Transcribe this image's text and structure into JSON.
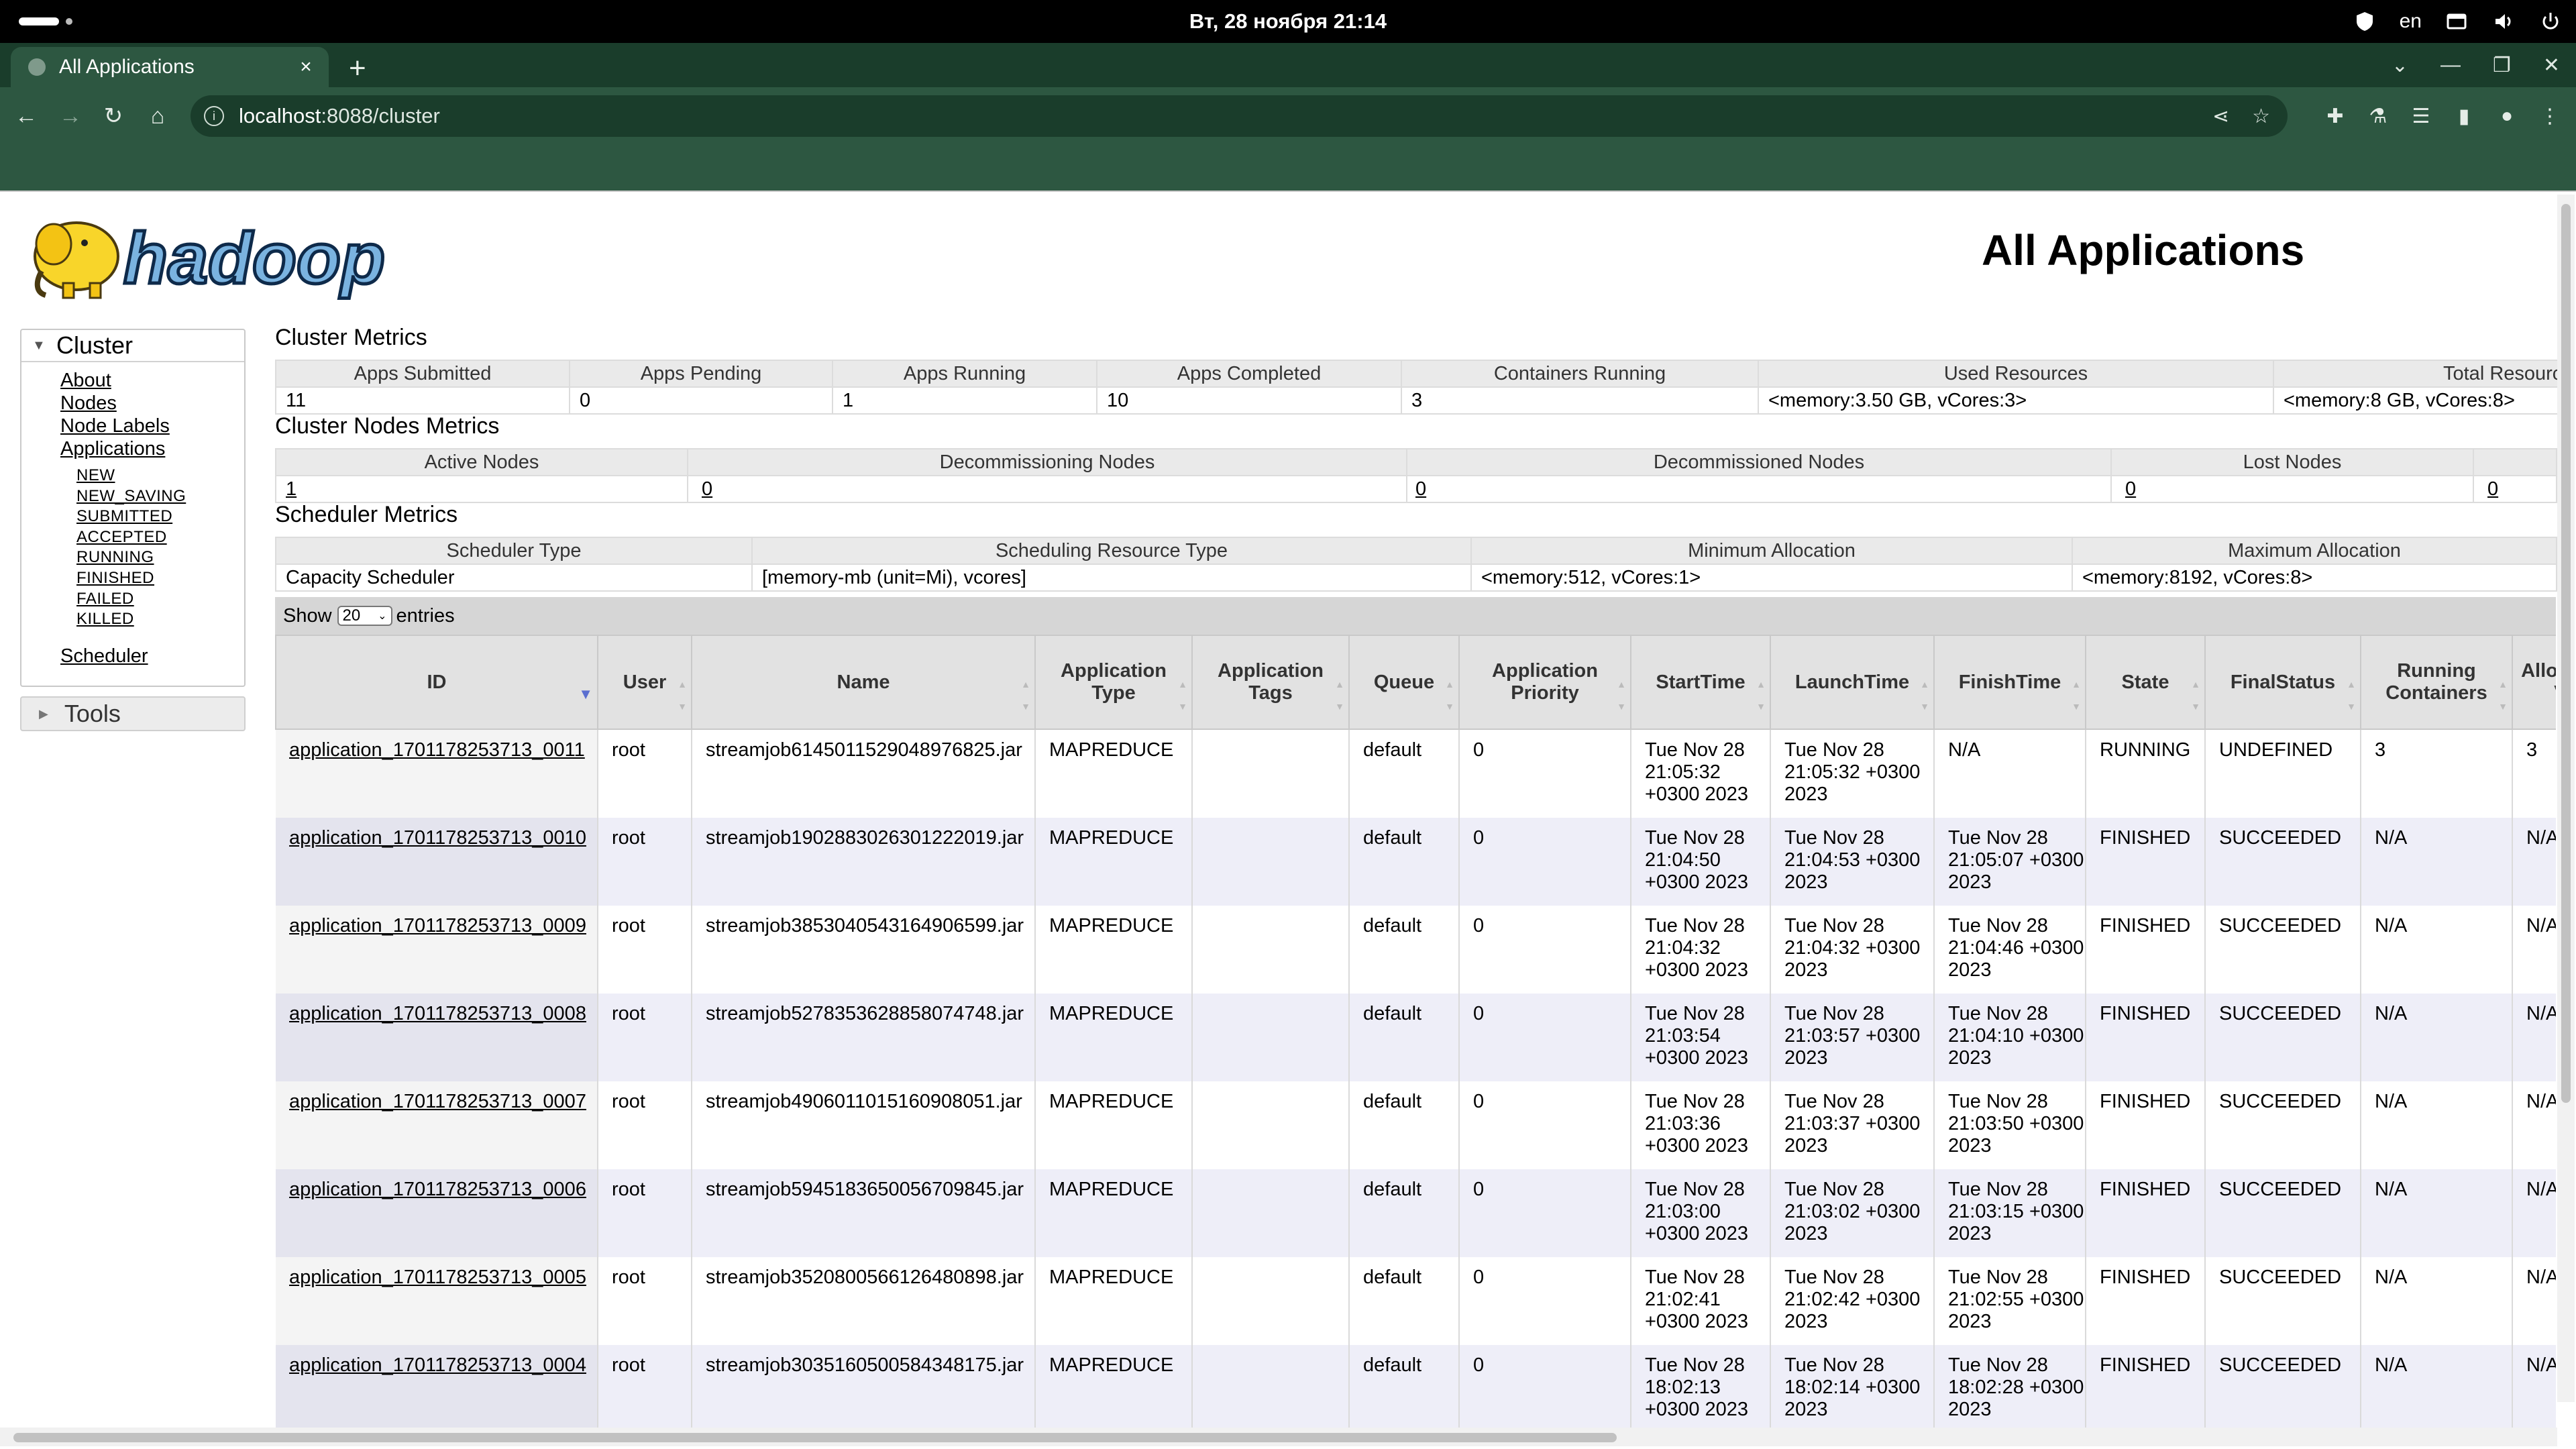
{
  "os_bar": {
    "clock": "Вт, 28 ноября  21:14",
    "language": "en"
  },
  "browser": {
    "tab_title": "All Applications",
    "tab_close": "×",
    "new_tab": "+",
    "url_host": "localhost",
    "url_rest": ":8088/cluster"
  },
  "page": {
    "logo_text": "hadoop",
    "title": "All Applications"
  },
  "sidebar": {
    "cluster_label": "Cluster",
    "links": [
      "About",
      "Nodes",
      "Node Labels",
      "Applications"
    ],
    "app_states": [
      "NEW",
      "NEW_SAVING",
      "SUBMITTED",
      "ACCEPTED",
      "RUNNING",
      "FINISHED",
      "FAILED",
      "KILLED"
    ],
    "scheduler_link": "Scheduler",
    "tools_label": "Tools"
  },
  "cluster_metrics": {
    "title": "Cluster Metrics",
    "headers": [
      "Apps Submitted",
      "Apps Pending",
      "Apps Running",
      "Apps Completed",
      "Containers Running",
      "Used Resources",
      "Total Resources"
    ],
    "values": [
      "11",
      "0",
      "1",
      "10",
      "3",
      "<memory:3.50 GB, vCores:3>",
      "<memory:8 GB, vCores:8>"
    ]
  },
  "node_metrics": {
    "title": "Cluster Nodes Metrics",
    "headers": [
      "Active Nodes",
      "Decommissioning Nodes",
      "Decommissioned Nodes",
      "Lost Nodes",
      ""
    ],
    "values": [
      "1",
      "0",
      "0",
      "0",
      "0"
    ]
  },
  "scheduler_metrics": {
    "title": "Scheduler Metrics",
    "headers": [
      "Scheduler Type",
      "Scheduling Resource Type",
      "Minimum Allocation",
      "Maximum Allocation"
    ],
    "values": [
      "Capacity Scheduler",
      "[memory-mb (unit=Mi), vcores]",
      "<memory:512, vCores:1>",
      "<memory:8192, vCores:8>"
    ]
  },
  "entries": {
    "show_label": "Show",
    "page_size": "20",
    "entries_label": "entries"
  },
  "apps_table": {
    "headers": [
      "ID",
      "User",
      "Name",
      "Application Type",
      "Application Tags",
      "Queue",
      "Application Priority",
      "StartTime",
      "LaunchTime",
      "FinishTime",
      "State",
      "FinalStatus",
      "Running Containers",
      "Allocated CPU VCores"
    ],
    "rows": [
      {
        "id": "application_1701178253713_0011",
        "user": "root",
        "name": "streamjob6145011529048976825.jar",
        "type": "MAPREDUCE",
        "tags": "",
        "queue": "default",
        "priority": "0",
        "start": "Tue Nov 28 21:05:32 +0300 2023",
        "launch": "Tue Nov 28 21:05:32 +0300 2023",
        "finish": "N/A",
        "state": "RUNNING",
        "final": "UNDEFINED",
        "containers": "3",
        "vcores": "3"
      },
      {
        "id": "application_1701178253713_0010",
        "user": "root",
        "name": "streamjob1902883026301222019.jar",
        "type": "MAPREDUCE",
        "tags": "",
        "queue": "default",
        "priority": "0",
        "start": "Tue Nov 28 21:04:50 +0300 2023",
        "launch": "Tue Nov 28 21:04:53 +0300 2023",
        "finish": "Tue Nov 28 21:05:07 +0300 2023",
        "state": "FINISHED",
        "final": "SUCCEEDED",
        "containers": "N/A",
        "vcores": "N/A"
      },
      {
        "id": "application_1701178253713_0009",
        "user": "root",
        "name": "streamjob3853040543164906599.jar",
        "type": "MAPREDUCE",
        "tags": "",
        "queue": "default",
        "priority": "0",
        "start": "Tue Nov 28 21:04:32 +0300 2023",
        "launch": "Tue Nov 28 21:04:32 +0300 2023",
        "finish": "Tue Nov 28 21:04:46 +0300 2023",
        "state": "FINISHED",
        "final": "SUCCEEDED",
        "containers": "N/A",
        "vcores": "N/A"
      },
      {
        "id": "application_1701178253713_0008",
        "user": "root",
        "name": "streamjob5278353628858074748.jar",
        "type": "MAPREDUCE",
        "tags": "",
        "queue": "default",
        "priority": "0",
        "start": "Tue Nov 28 21:03:54 +0300 2023",
        "launch": "Tue Nov 28 21:03:57 +0300 2023",
        "finish": "Tue Nov 28 21:04:10 +0300 2023",
        "state": "FINISHED",
        "final": "SUCCEEDED",
        "containers": "N/A",
        "vcores": "N/A"
      },
      {
        "id": "application_1701178253713_0007",
        "user": "root",
        "name": "streamjob4906011015160908051.jar",
        "type": "MAPREDUCE",
        "tags": "",
        "queue": "default",
        "priority": "0",
        "start": "Tue Nov 28 21:03:36 +0300 2023",
        "launch": "Tue Nov 28 21:03:37 +0300 2023",
        "finish": "Tue Nov 28 21:03:50 +0300 2023",
        "state": "FINISHED",
        "final": "SUCCEEDED",
        "containers": "N/A",
        "vcores": "N/A"
      },
      {
        "id": "application_1701178253713_0006",
        "user": "root",
        "name": "streamjob5945183650056709845.jar",
        "type": "MAPREDUCE",
        "tags": "",
        "queue": "default",
        "priority": "0",
        "start": "Tue Nov 28 21:03:00 +0300 2023",
        "launch": "Tue Nov 28 21:03:02 +0300 2023",
        "finish": "Tue Nov 28 21:03:15 +0300 2023",
        "state": "FINISHED",
        "final": "SUCCEEDED",
        "containers": "N/A",
        "vcores": "N/A"
      },
      {
        "id": "application_1701178253713_0005",
        "user": "root",
        "name": "streamjob3520800566126480898.jar",
        "type": "MAPREDUCE",
        "tags": "",
        "queue": "default",
        "priority": "0",
        "start": "Tue Nov 28 21:02:41 +0300 2023",
        "launch": "Tue Nov 28 21:02:42 +0300 2023",
        "finish": "Tue Nov 28 21:02:55 +0300 2023",
        "state": "FINISHED",
        "final": "SUCCEEDED",
        "containers": "N/A",
        "vcores": "N/A"
      },
      {
        "id": "application_1701178253713_0004",
        "user": "root",
        "name": "streamjob3035160500584348175.jar",
        "type": "MAPREDUCE",
        "tags": "",
        "queue": "default",
        "priority": "0",
        "start": "Tue Nov 28 18:02:13 +0300 2023",
        "launch": "Tue Nov 28 18:02:14 +0300 2023",
        "finish": "Tue Nov 28 18:02:28 +0300 2023",
        "state": "FINISHED",
        "final": "SUCCEEDED",
        "containers": "N/A",
        "vcores": "N/A"
      }
    ]
  }
}
